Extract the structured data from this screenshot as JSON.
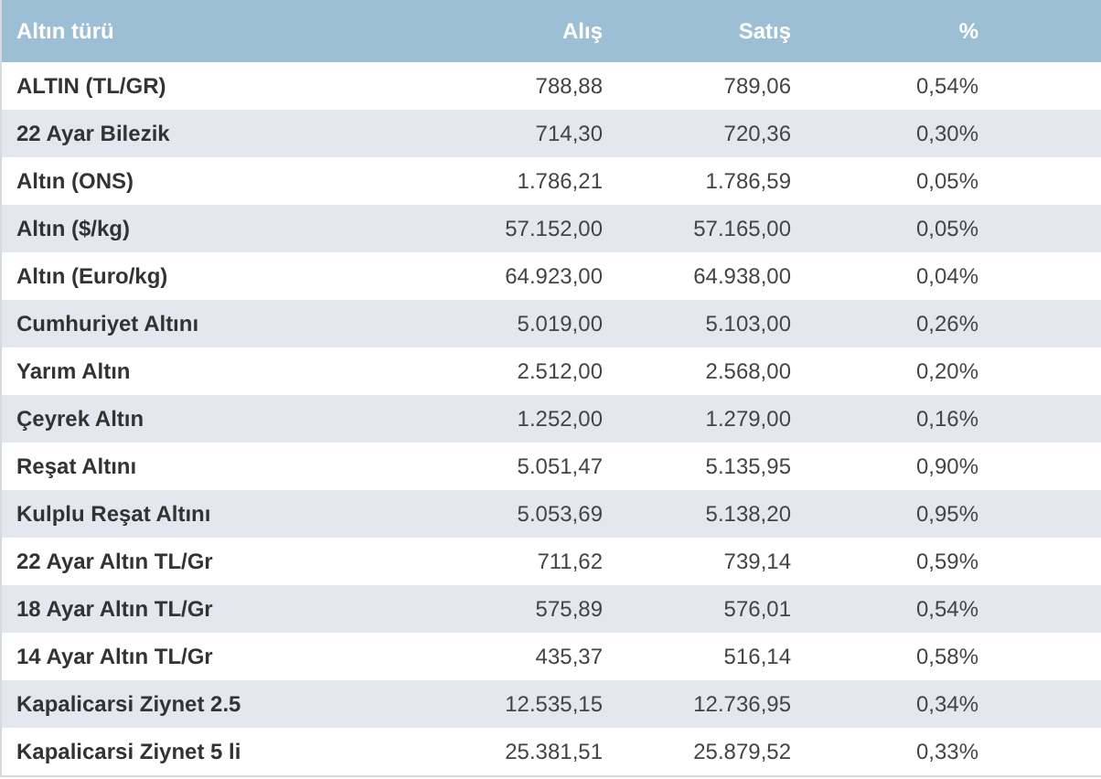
{
  "table": {
    "columns": [
      "Altın türü",
      "Alış",
      "Satış",
      "%"
    ],
    "rows": [
      [
        "ALTIN (TL/GR)",
        "788,88",
        "789,06",
        "0,54%"
      ],
      [
        "22 Ayar Bilezik",
        "714,30",
        "720,36",
        "0,30%"
      ],
      [
        "Altın (ONS)",
        "1.786,21",
        "1.786,59",
        "0,05%"
      ],
      [
        "Altın ($/kg)",
        "57.152,00",
        "57.165,00",
        "0,05%"
      ],
      [
        "Altın (Euro/kg)",
        "64.923,00",
        "64.938,00",
        "0,04%"
      ],
      [
        "Cumhuriyet Altını",
        "5.019,00",
        "5.103,00",
        "0,26%"
      ],
      [
        "Yarım Altın",
        "2.512,00",
        "2.568,00",
        "0,20%"
      ],
      [
        "Çeyrek Altın",
        "1.252,00",
        "1.279,00",
        "0,16%"
      ],
      [
        "Reşat Altını",
        "5.051,47",
        "5.135,95",
        "0,90%"
      ],
      [
        "Kulplu Reşat Altını",
        "5.053,69",
        "5.138,20",
        "0,95%"
      ],
      [
        "22 Ayar Altın TL/Gr",
        "711,62",
        "739,14",
        "0,59%"
      ],
      [
        "18 Ayar Altın TL/Gr",
        "575,89",
        "576,01",
        "0,54%"
      ],
      [
        "14 Ayar Altın TL/Gr",
        "435,37",
        "516,14",
        "0,58%"
      ],
      [
        "Kapalicarsi Ziynet 2.5",
        "12.535,15",
        "12.736,95",
        "0,34%"
      ],
      [
        "Kapalicarsi Ziynet 5 li",
        "25.381,51",
        "25.879,52",
        "0,33%"
      ]
    ]
  }
}
